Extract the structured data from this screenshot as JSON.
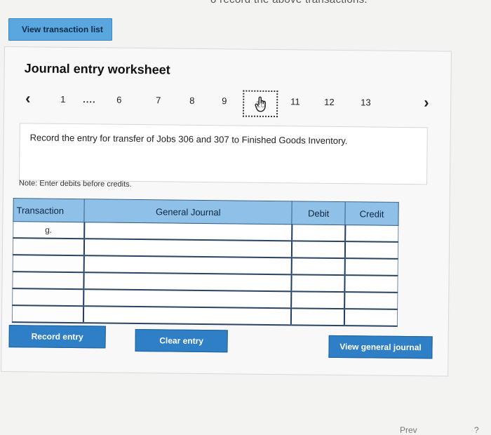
{
  "top_text": "o record the above transactions.",
  "view_transaction_list": "View transaction list",
  "worksheet": {
    "title": "Journal entry worksheet",
    "pager": {
      "prev_icon": "chevron-left-icon",
      "items": [
        "1",
        "....",
        "6",
        "7",
        "8",
        "9",
        "10",
        "11",
        "12",
        "13"
      ],
      "current": "10",
      "next_icon": "chevron-right-icon"
    },
    "instruction": "Record the entry for transfer of Jobs 306 and 307 to Finished Goods Inventory.",
    "note": "Note: Enter debits before credits.",
    "table": {
      "headers": [
        "Transaction",
        "General Journal",
        "Debit",
        "Credit"
      ],
      "rows": [
        {
          "transaction": "g.",
          "general_journal": "",
          "debit": "",
          "credit": ""
        },
        {
          "transaction": "",
          "general_journal": "",
          "debit": "",
          "credit": ""
        },
        {
          "transaction": "",
          "general_journal": "",
          "debit": "",
          "credit": ""
        },
        {
          "transaction": "",
          "general_journal": "",
          "debit": "",
          "credit": ""
        },
        {
          "transaction": "",
          "general_journal": "",
          "debit": "",
          "credit": ""
        },
        {
          "transaction": "",
          "general_journal": "",
          "debit": "",
          "credit": ""
        }
      ]
    },
    "buttons": {
      "record": "Record entry",
      "clear": "Clear entry",
      "view_journal": "View general journal"
    }
  },
  "bottom_prev": "Prev",
  "bottom_next": "?"
}
